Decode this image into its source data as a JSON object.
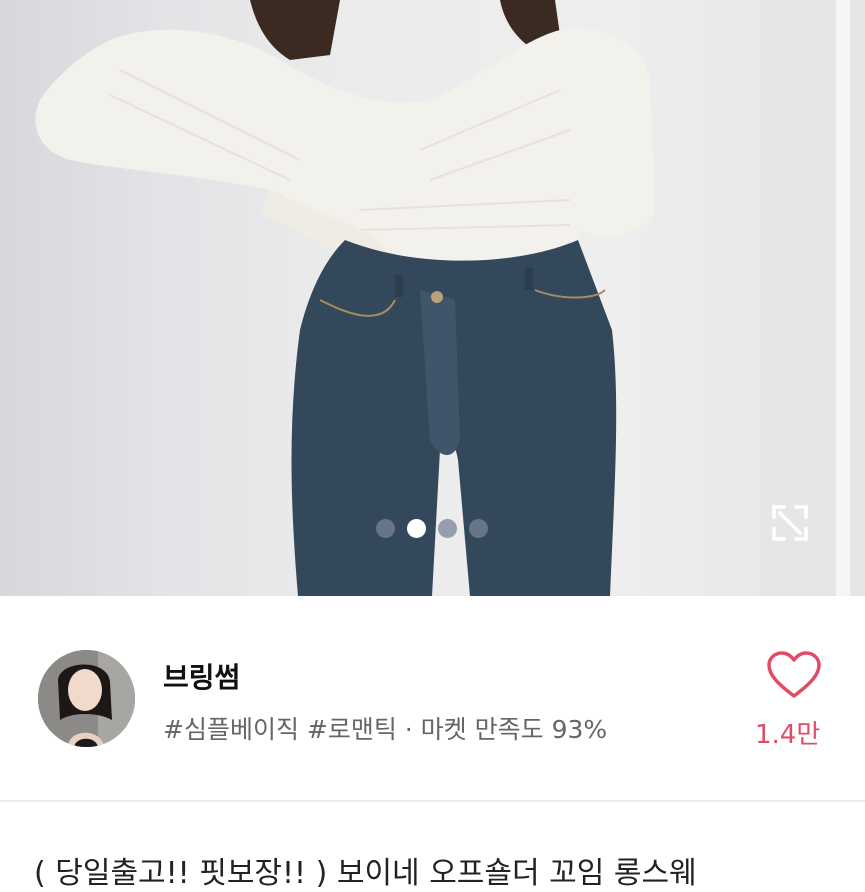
{
  "product_image": {
    "carousel": {
      "count": 4,
      "active_index": 1
    },
    "expand_icon": "expand-icon"
  },
  "seller": {
    "name": "브링썸",
    "tags": "#심플베이직 #로맨틱 · 마켓 만족도 93%",
    "like_icon": "heart-outline-icon",
    "like_count": "1.4만",
    "accent_color": "#e24b66"
  },
  "product": {
    "title_peek": "( 당일출고!! 핏보장!! ) 보이네 오프숄더 꼬임 롱스웨"
  }
}
